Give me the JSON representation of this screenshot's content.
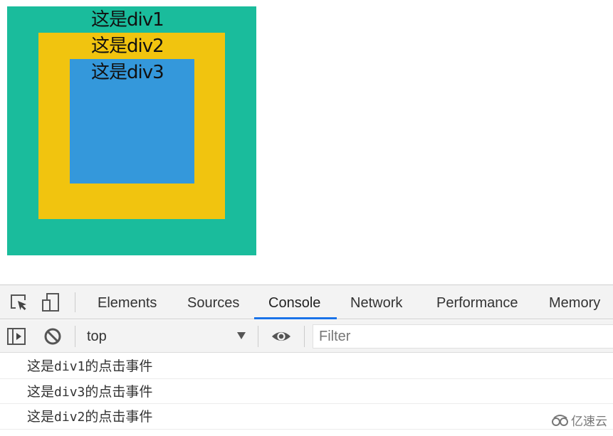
{
  "page": {
    "boxes": [
      {
        "id": "div1",
        "label": "这是div1",
        "color": "#1abc9c"
      },
      {
        "id": "div2",
        "label": "这是div2",
        "color": "#f1c40f"
      },
      {
        "id": "div3",
        "label": "这是div3",
        "color": "#3498db"
      }
    ]
  },
  "devtools": {
    "tabs": [
      {
        "label": "Elements",
        "active": false
      },
      {
        "label": "Sources",
        "active": false
      },
      {
        "label": "Console",
        "active": true
      },
      {
        "label": "Network",
        "active": false
      },
      {
        "label": "Performance",
        "active": false
      },
      {
        "label": "Memory",
        "active": false
      }
    ],
    "accent_color": "#1a73e8",
    "icons": {
      "inspect": "inspect-element-icon",
      "device": "device-toolbar-icon",
      "sidebar": "show-console-sidebar-icon",
      "clear": "clear-console-icon",
      "eye": "live-expression-icon"
    },
    "toolbar": {
      "context": "top",
      "filter_value": "",
      "filter_placeholder": "Filter"
    },
    "console_messages": [
      {
        "prefix": "这是",
        "code": "div1",
        "suffix": "的点击事件"
      },
      {
        "prefix": "这是",
        "code": "div3",
        "suffix": "的点击事件"
      },
      {
        "prefix": "这是",
        "code": "div2",
        "suffix": "的点击事件"
      }
    ]
  },
  "watermark": {
    "text": "亿速云",
    "icon": "cloud-logo-icon"
  }
}
